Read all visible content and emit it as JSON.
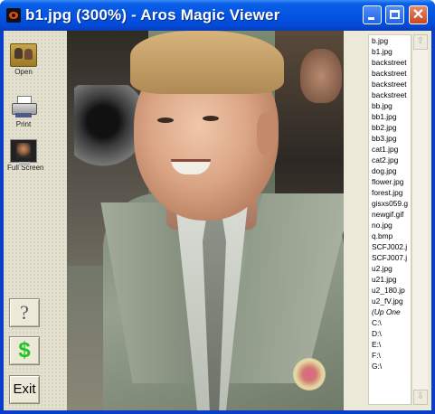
{
  "window": {
    "title": "b1.jpg (300%) - Aros Magic Viewer"
  },
  "toolbar": {
    "open_label": "Open",
    "print_label": "Print",
    "fullscreen_label": "Full Screen",
    "help_label": "?",
    "donate_label": "$",
    "exit_label": "Exit"
  },
  "file_list": {
    "items": [
      "b.jpg",
      "b1.jpg",
      "backstreet",
      "backstreet",
      "backstreet",
      "backstreet",
      "bb.jpg",
      "bb1.jpg",
      "bb2.jpg",
      "bb3.jpg",
      "cat1.jpg",
      "cat2.jpg",
      "dog.jpg",
      "flower.jpg",
      "forest.jpg",
      "gisxs059.g",
      "newgif.gif",
      "no.jpg",
      "q.bmp",
      "SCFJ002.j",
      "SCFJ007.j",
      "u2.jpg",
      "u21.jpg",
      "u2_180.jp",
      "u2_fV.jpg",
      "(Up One",
      "C:\\",
      "D:\\",
      "E:\\",
      "F:\\",
      "G:\\"
    ],
    "selected_index": 1
  },
  "colors": {
    "titlebar": "#0454e4",
    "close_button": "#c8461e",
    "donate_symbol": "#22c422"
  }
}
